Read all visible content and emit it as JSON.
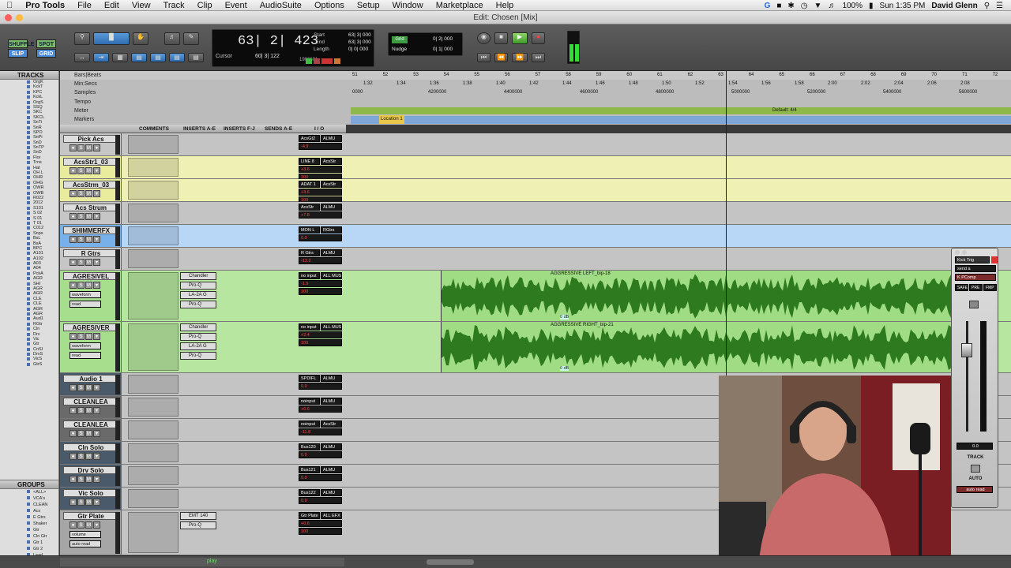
{
  "menubar": {
    "app": "Pro Tools",
    "items": [
      "File",
      "Edit",
      "View",
      "Track",
      "Clip",
      "Event",
      "AudioSuite",
      "Options",
      "Setup",
      "Window",
      "Marketplace",
      "Help"
    ],
    "battery": "100%",
    "clock": "Sun 1:35 PM",
    "user": "David Glenn"
  },
  "window": {
    "title": "Edit: Chosen [Mix]"
  },
  "toolbar": {
    "modes": [
      "SHUFFLE",
      "SPOT",
      "SLIP",
      "GRID"
    ],
    "main_counter": "63| 2| 423",
    "cursor_label": "Cursor",
    "cursor_value": "60| 3| 122",
    "samples": "1900601",
    "start_label": "Start",
    "end_label": "End",
    "length_label": "Length",
    "start": "63| 3| 000",
    "end": "63| 3| 000",
    "length": "0| 0| 000",
    "grid_label": "Grid",
    "grid_value": "0| 2| 000",
    "nudge_label": "Nudge",
    "nudge_value": "0| 1| 000"
  },
  "tracks_header": "TRACKS",
  "groups_header": "GROUPS",
  "tracklist": [
    "OrgK",
    "KckT",
    "KPC",
    "KckL",
    "OrgS",
    "SSQ",
    "SKC",
    "SKCL",
    "SnTi",
    "SnR",
    "SPO",
    "SnPi",
    "SnD",
    "SnTP",
    "SnD",
    "Flor",
    "Trns",
    "Hat",
    "OH L",
    "OHR",
    "OHG",
    "OWR",
    "OWB",
    "R022",
    "2012",
    "S101",
    "S 02",
    "S 01",
    "T 01",
    "C012",
    "Snps",
    "BsL",
    "BsA",
    "BPC",
    "A101",
    "A102",
    "A03",
    "A04",
    "PckA",
    "AGR",
    "SHI",
    "AGR",
    "AGR",
    "CLE",
    "CLE",
    "AGR",
    "AGR",
    "Aud1",
    "RGtr",
    "Cln",
    "Drv",
    "Vic",
    "Gtr",
    "CnSI",
    "DrvS",
    "VicS",
    "GtrS"
  ],
  "groups": [
    "<ALL>",
    "VCA's",
    "CLEAN",
    "Acs",
    "E Gtrs",
    "Shaker",
    "Gtr",
    "Cln Gtr",
    "Gtr 1",
    "Gtr 2",
    "Lead"
  ],
  "rulers": {
    "labels": [
      "Bars|Beats",
      "Min:Secs",
      "Samples",
      "Tempo",
      "Meter",
      "Markers"
    ],
    "bars": [
      "51",
      "52",
      "53",
      "54",
      "55",
      "56",
      "57",
      "58",
      "59",
      "60",
      "61",
      "62",
      "63",
      "64",
      "65",
      "66",
      "67",
      "68",
      "69",
      "70",
      "71",
      "72"
    ],
    "minsecs": [
      "1:32",
      "1:34",
      "1:36",
      "1:38",
      "1:40",
      "1:42",
      "1:44",
      "1:46",
      "1:48",
      "1:50",
      "1:52",
      "1:54",
      "1:56",
      "1:58",
      "2:00",
      "2:02",
      "2:04",
      "2:06",
      "2:08"
    ],
    "samples": [
      "0000",
      "4200000",
      "4400000",
      "4600000",
      "4800000",
      "5000000",
      "5200000",
      "5400000",
      "5600000"
    ],
    "meter": "Default: 4/4",
    "marker": "Location 1"
  },
  "columns": [
    "COMMENTS",
    "INSERTS A-E",
    "INSERTS F-J",
    "SENDS A-E",
    "I / O"
  ],
  "tracks": [
    {
      "name": "Pick Acs",
      "io1": "AcsGt2",
      "io2": "ALMU",
      "vol": "-4.9"
    },
    {
      "name": "AcsStr1_03",
      "io1": "LINE 8",
      "io2": "AcsStr",
      "vol": "+3.6",
      "pan": "100"
    },
    {
      "name": "AcsStrm_03",
      "io1": "ADAT 1",
      "io2": "AcsStr",
      "vol": "+3.6",
      "pan": "100"
    },
    {
      "name": "Acs Strum",
      "io1": "AcsStr",
      "io2": "ALMU",
      "vol": "+7.8"
    },
    {
      "name": "SHIMMERFX",
      "io1": "MON L",
      "io2": "RGtrs",
      "vol": "0.0"
    },
    {
      "name": "R Gtrs",
      "io1": "R Gtrs",
      "io2": "ALMU",
      "vol": "-13.2"
    },
    {
      "name": "AGRESIVEL",
      "plugins": [
        "Chandler",
        "Pro-Q",
        "LA-2A G",
        "Pro-Q"
      ],
      "io1": "no input",
      "io2": "ALL MUSIC",
      "vol": "-1.9",
      "pan": "100",
      "clip": "AGGRESSIVE LEFT_bip-18",
      "gain": "0 dB",
      "mode": "waveform",
      "auto": "read"
    },
    {
      "name": "AGRESIVER",
      "plugins": [
        "Chandler",
        "Pro-Q",
        "LA-2A G",
        "Pro-Q"
      ],
      "io1": "no input",
      "io2": "ALL MUSIC",
      "vol": "+2.4",
      "pan": "100",
      "clip": "AGGRESSIVE RIGHT_bip-21",
      "gain": "0 dB",
      "mode": "waveform",
      "auto": "read"
    },
    {
      "name": "Audio 1",
      "io1": "SPDIFL",
      "io2": "ALMU",
      "vol": "0.0"
    },
    {
      "name": "CLEANLEA",
      "io1": "noinput",
      "io2": "ALMU",
      "vol": "+0.6"
    },
    {
      "name": "CLEANLEA",
      "io1": "noinput",
      "io2": "AcsStr",
      "vol": "-11.8"
    },
    {
      "name": "Cln Solo",
      "io1": "Bus120",
      "io2": "ALMU",
      "vol": "0.0"
    },
    {
      "name": "Drv Solo",
      "io1": "Bus121",
      "io2": "ALMU",
      "vol": "0.0"
    },
    {
      "name": "Vic Solo",
      "io1": "Bus122",
      "io2": "ALMU",
      "vol": "0.0"
    },
    {
      "name": "Gtr Plate",
      "plugins": [
        "EMT 140",
        "Pro-Q"
      ],
      "io1": "Gtr Plate",
      "io2": "ALL EFX",
      "vol": "+0.6",
      "pan": "100",
      "mode": "volume",
      "auto": "auto read"
    }
  ],
  "floater": {
    "name": "Kick Trig",
    "send": "send a",
    "out": "K PComp",
    "buttons": [
      "SAFE",
      "PRE",
      "FMP"
    ],
    "vol": "0.0",
    "track": "TRACK",
    "auto_label": "AUTO",
    "auto": "auto read"
  },
  "status": {
    "play": "play"
  }
}
